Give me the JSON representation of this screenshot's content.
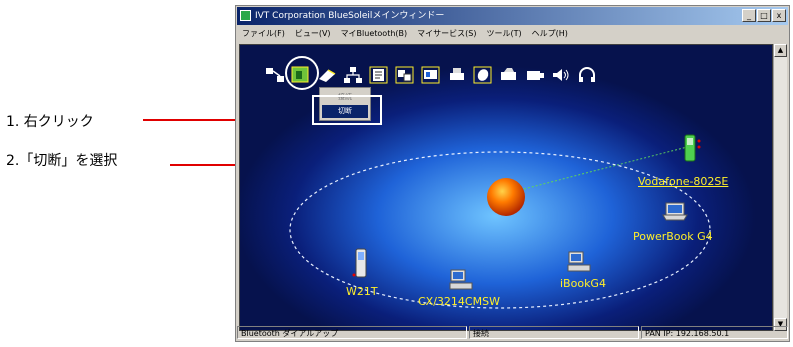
{
  "annotations": {
    "step1": "1. 右クリック",
    "step2": "2.「切断」を選択"
  },
  "window": {
    "title": "IVT Corporation BlueSoleilメインウィンドー",
    "buttons": [
      "_",
      "□",
      "x"
    ]
  },
  "menu": [
    "ファイル(F)",
    "ビュー(V)",
    "マイBluetooth(B)",
    "マイサービス(S)",
    "ツール(T)",
    "ヘルプ(H)"
  ],
  "context_menu": {
    "items": [
      "接続",
      "切断"
    ]
  },
  "devices": [
    {
      "name": "Vodafone-802SE",
      "icon": "mobile-phone-icon"
    },
    {
      "name": "PowerBook G4",
      "icon": "laptop-icon"
    },
    {
      "name": "iBookG4",
      "icon": "desktop-pc-icon"
    },
    {
      "name": "CX/3214CMSW",
      "icon": "desktop-pc-icon"
    },
    {
      "name": "W21T",
      "icon": "mobile-phone-icon"
    }
  ],
  "status": {
    "left": "Bluetooth ダイアルアップ",
    "middle": "接続",
    "right": "PAN IP: 192.168.50.1"
  },
  "colors": {
    "accent": "#e00000",
    "device_label": "#ffef2a",
    "title_bar": "#0a246a"
  }
}
